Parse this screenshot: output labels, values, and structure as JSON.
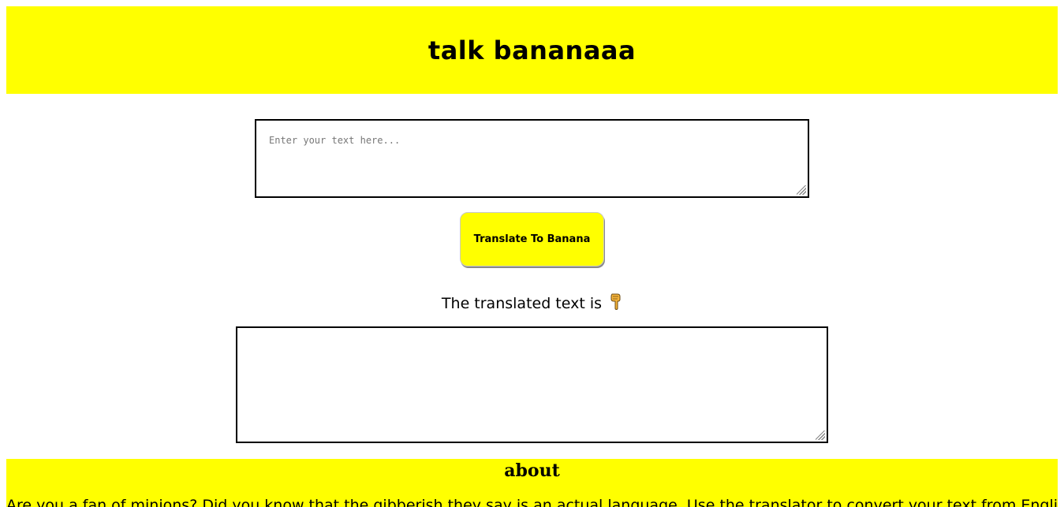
{
  "header": {
    "title": "talk bananaaa"
  },
  "input": {
    "placeholder": "Enter your text here...",
    "value": ""
  },
  "translate_button": {
    "label": "Translate To Banana"
  },
  "output": {
    "label": "The translated text is",
    "label_icon": "backhand-index-pointing-down-icon",
    "value": ""
  },
  "about": {
    "heading": "about",
    "text": "Are you a fan of minions? Did you know that the gibberish they say is an actual language. Use the translator to convert your text from English to"
  },
  "colors": {
    "accent": "#ffff00",
    "border": "#000000",
    "background": "#ffffff"
  }
}
